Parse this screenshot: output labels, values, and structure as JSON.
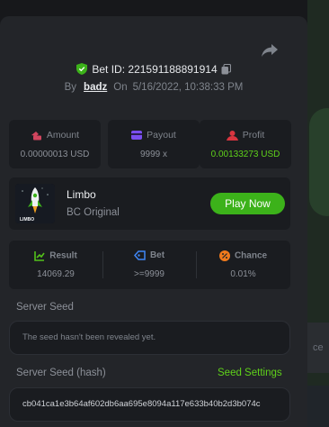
{
  "header": {
    "top_label": "",
    "bet_id_label": "Bet ID:",
    "bet_id": "221591188891914",
    "by_label": "By",
    "user": "badz",
    "on_label": "On",
    "date": "5/16/2022, 10:38:33 PM"
  },
  "stats": [
    {
      "label": "Amount",
      "value": "0.00000013 USD",
      "icon": "money-icon",
      "color": "#d0455e"
    },
    {
      "label": "Payout",
      "value": "9999 x",
      "icon": "card-icon",
      "color": "#7a4ef0"
    },
    {
      "label": "Profit",
      "value": "0.00133273 USD",
      "icon": "profit-icon",
      "color": "#d8353f"
    }
  ],
  "game": {
    "name": "Limbo",
    "provider": "BC Original",
    "thumb_text": "LIMBO",
    "play_label": "Play Now"
  },
  "result": [
    {
      "label": "Result",
      "value": "14069.29",
      "icon": "chart-icon",
      "color": "#53c21a"
    },
    {
      "label": "Bet",
      "value": ">=9999",
      "icon": "ticket-icon",
      "color": "#3f86f5"
    },
    {
      "label": "Chance",
      "value": "0.01%",
      "icon": "percent-icon",
      "color": "#f07a1c"
    }
  ],
  "seeds": {
    "server_seed_label": "Server Seed",
    "server_seed_value": "The seed hasn't been revealed yet.",
    "server_hash_label": "Server Seed (hash)",
    "seed_settings_label": "Seed Settings",
    "server_hash_value": "cb041ca1e3b64af602db6aa695e8094a117e633b40b2d3b074c"
  },
  "background": {
    "right_input_text": "ce"
  },
  "colors": {
    "accent_green": "#3cb21a",
    "profit_green": "#5fd11a"
  }
}
